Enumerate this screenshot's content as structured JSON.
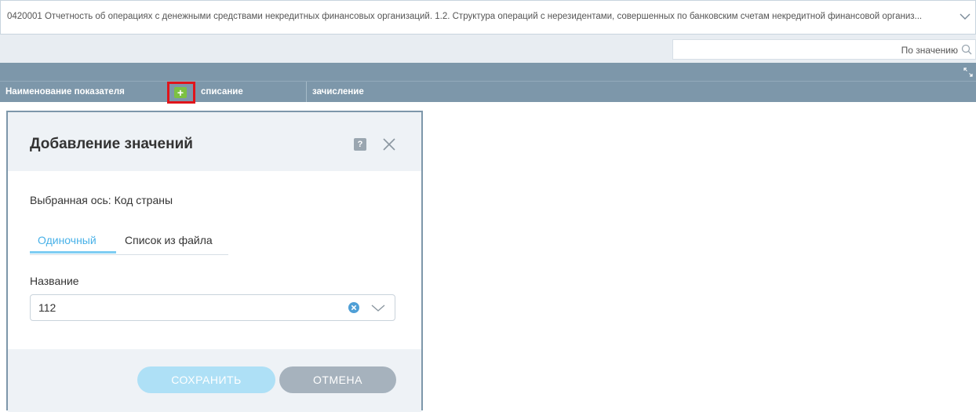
{
  "report": {
    "title": "0420001 Отчетность об операциях с денежными средствами некредитных финансовых организаций. 1.2. Структура операций с нерезидентами, совершенных по банковским счетам  некредитной финансовой организ..."
  },
  "search": {
    "text": "По значению"
  },
  "columns": {
    "indicator": "Наименование показателя",
    "add": "+",
    "debit": "списание",
    "credit": "зачисление"
  },
  "dialog": {
    "title": "Добавление значений",
    "help": "?",
    "axis_text": "Выбранная ось: Код страны",
    "tabs": [
      "Одиночный",
      "Список из файла"
    ],
    "name_label": "Название",
    "name_value": "112",
    "save_label": "СОХРАНИТЬ",
    "cancel_label": "ОТМЕНА"
  },
  "colors": {
    "header_band": "#7d97aa",
    "accent": "#48b1e8",
    "add_button": "#7cc142",
    "highlight_frame": "#e0141b"
  }
}
